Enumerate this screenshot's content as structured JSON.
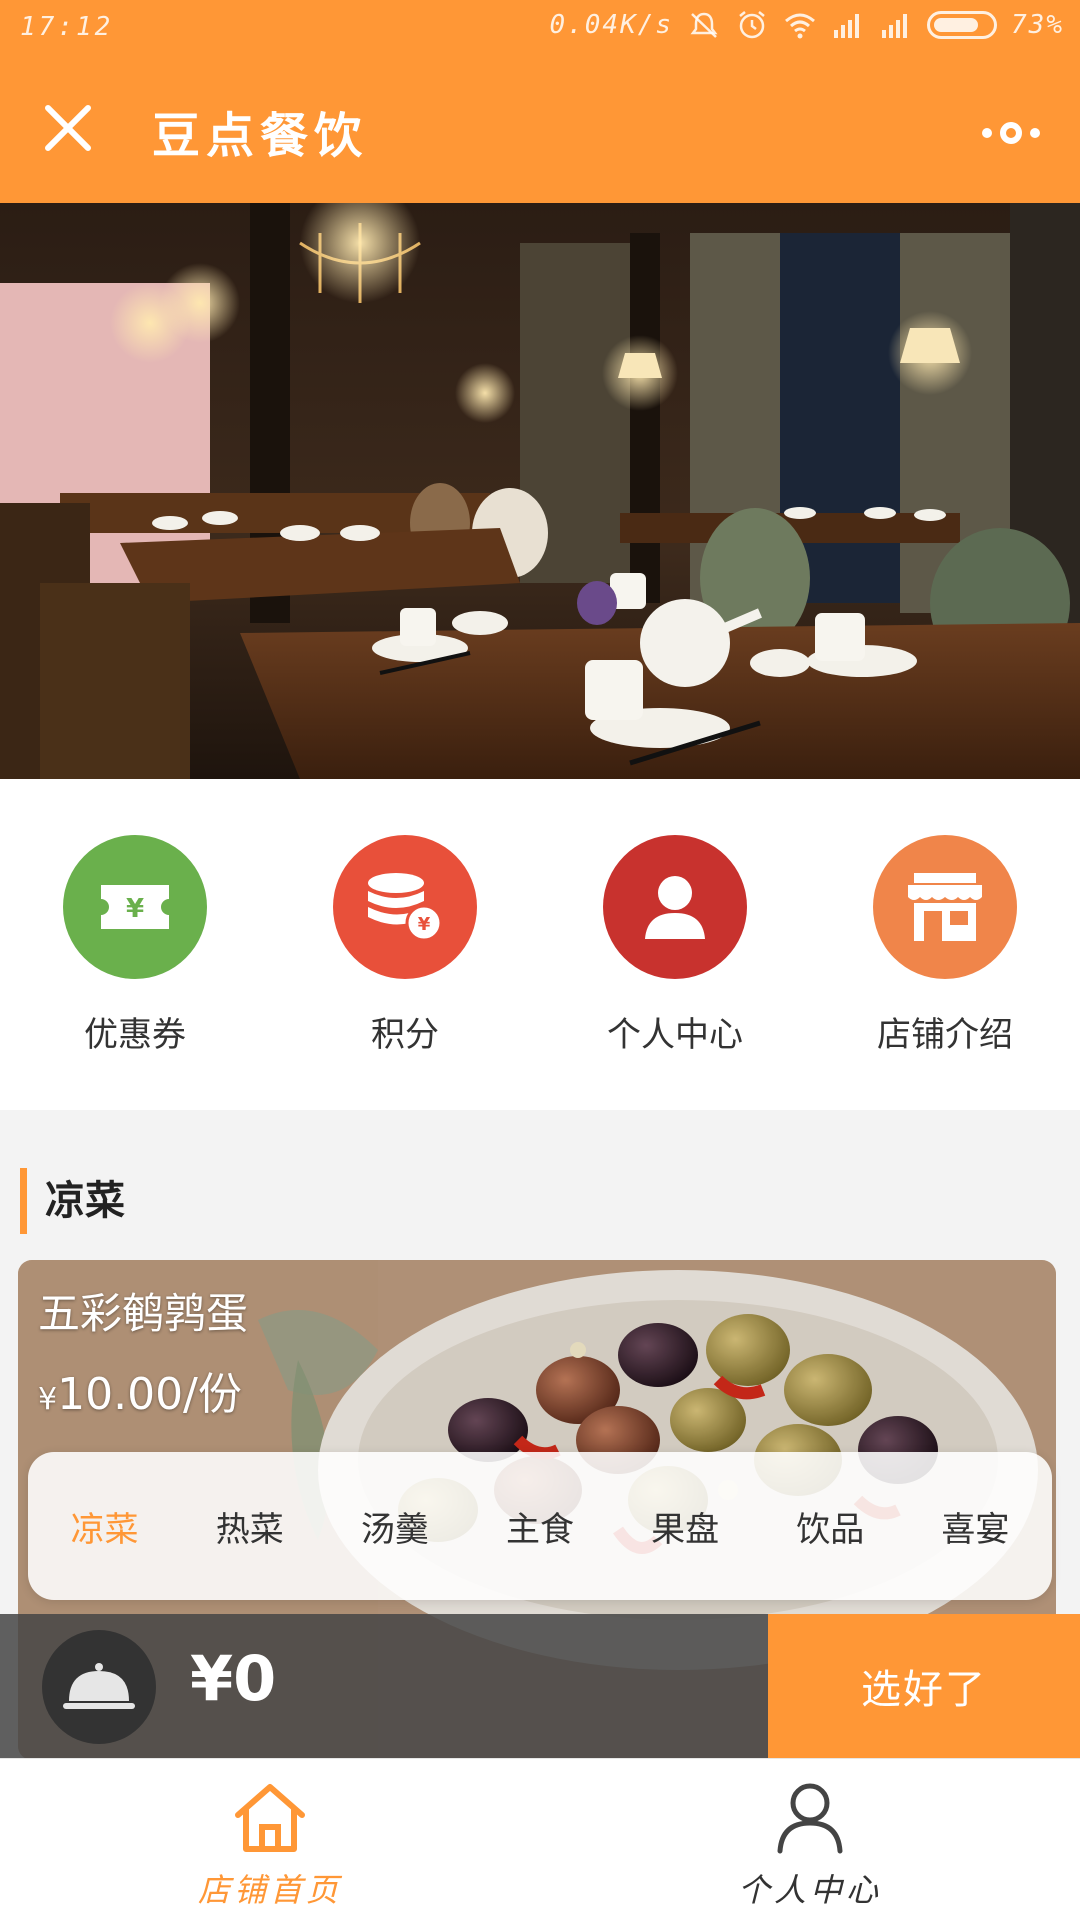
{
  "status_bar": {
    "time": "17:12",
    "speed": "0.04K/s",
    "battery": "73%"
  },
  "header": {
    "title": "豆点餐饮"
  },
  "quick_links": [
    {
      "label": "优惠券",
      "icon": "coupon-icon",
      "color": "#6ab04c"
    },
    {
      "label": "积分",
      "icon": "points-coins-icon",
      "color": "#e8503a"
    },
    {
      "label": "个人中心",
      "icon": "user-icon",
      "color": "#c8322e"
    },
    {
      "label": "店铺介绍",
      "icon": "store-icon",
      "color": "#f0854a"
    }
  ],
  "section": {
    "title": "凉菜"
  },
  "dish": {
    "name": "五彩鹌鹑蛋",
    "price_symbol": "¥",
    "price": "10.00/份"
  },
  "categories": [
    {
      "label": "凉菜",
      "active": true
    },
    {
      "label": "热菜",
      "active": false
    },
    {
      "label": "汤羹",
      "active": false
    },
    {
      "label": "主食",
      "active": false
    },
    {
      "label": "果盘",
      "active": false
    },
    {
      "label": "饮品",
      "active": false
    },
    {
      "label": "喜宴",
      "active": false
    }
  ],
  "cart": {
    "total": "¥0",
    "checkout_label": "选好了"
  },
  "bottom_nav": [
    {
      "label": "店铺首页",
      "icon": "home-icon",
      "active": true
    },
    {
      "label": "个人中心",
      "icon": "user-outline-icon",
      "active": false
    }
  ],
  "colors": {
    "accent": "#ff9736",
    "cart_bar": "#464646"
  }
}
